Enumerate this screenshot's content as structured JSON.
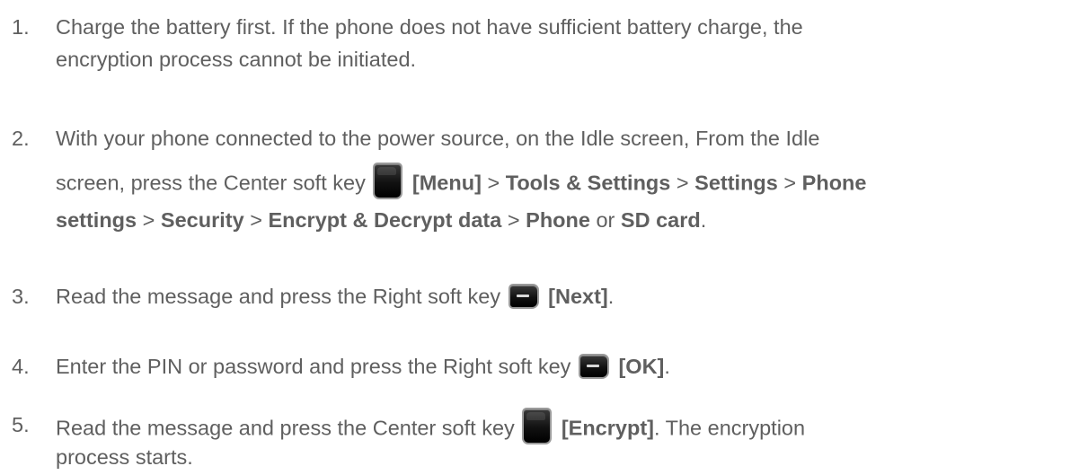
{
  "steps": [
    {
      "number": "1.",
      "line1": "Charge the battery first. If the phone does not have sufficient battery charge, the",
      "line2": "encryption process cannot be initiated."
    },
    {
      "number": "2.",
      "line1": "With your phone connected to the power source, on the Idle screen, From the Idle",
      "line2_prefix": "screen, press the Center soft key",
      "menu": "[Menu]",
      "sep": ">",
      "tools": "Tools & Settings",
      "settings": "Settings",
      "phone_word": "Phone",
      "settings_word": "settings",
      "security": "Security",
      "encrypt_decrypt": "Encrypt & Decrypt data",
      "phone": "Phone",
      "or": "or",
      "sd_card": "SD card",
      "period": "."
    },
    {
      "number": "3.",
      "prefix": "Read the message and press the Right soft key",
      "key_label": "[Next]",
      "suffix": "."
    },
    {
      "number": "4.",
      "prefix": "Enter the PIN or password and press the Right soft key",
      "key_label": "[OK]",
      "suffix": "."
    },
    {
      "number": "5.",
      "prefix": "Read the message and press the Center soft key",
      "key_label": "[Encrypt]",
      "suffix": ". The encryption",
      "line2": "process starts."
    }
  ],
  "icons": {
    "center_soft_key": "center-soft-key-icon",
    "right_soft_key": "right-soft-key-icon"
  }
}
